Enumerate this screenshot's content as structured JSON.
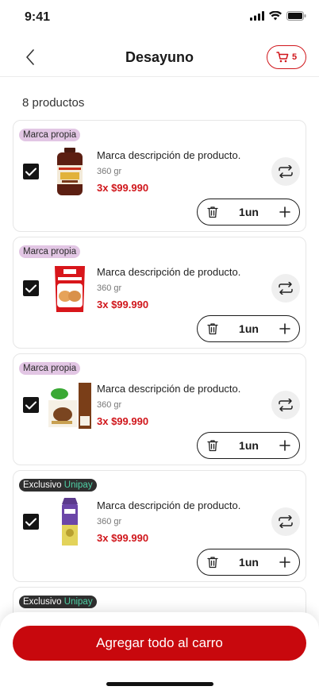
{
  "status": {
    "time": "9:41"
  },
  "header": {
    "title": "Desayuno",
    "cart_count": "5"
  },
  "summary": {
    "count_label": "8 productos"
  },
  "products": [
    {
      "badge_type": "own",
      "badge": "Marca propia",
      "badge_accent": "",
      "checked": true,
      "name": "Marca descripción de producto.",
      "weight": "360 gr",
      "price": "3x $99.990",
      "qty": "1un",
      "image": "jam-jar"
    },
    {
      "badge_type": "own",
      "badge": "Marca propia",
      "badge_accent": "",
      "checked": true,
      "name": "Marca descripción de producto.",
      "weight": "360 gr",
      "price": "3x $99.990",
      "qty": "1un",
      "image": "bread-bag"
    },
    {
      "badge_type": "own",
      "badge": "Marca propia",
      "badge_accent": "",
      "checked": true,
      "name": "Marca descripción de producto.",
      "weight": "360 gr",
      "price": "3x $99.990",
      "qty": "1un",
      "image": "cereal-box"
    },
    {
      "badge_type": "excl",
      "badge": "Exclusivo ",
      "badge_accent": "Unipay",
      "checked": true,
      "name": "Marca descripción de producto.",
      "weight": "360 gr",
      "price": "3x $99.990",
      "qty": "1un",
      "image": "juice-carton"
    },
    {
      "badge_type": "excl",
      "badge": "Exclusivo ",
      "badge_accent": "Unipay",
      "checked": true,
      "name": "",
      "weight": "",
      "price": "",
      "qty": "",
      "image": ""
    }
  ],
  "footer": {
    "cta_label": "Agregar todo al carro"
  },
  "colors": {
    "brand_red": "#c8080d",
    "own_badge": "#e2c6e4",
    "excl_badge": "#2f2f2f",
    "unipay_green": "#4fd1a6"
  }
}
